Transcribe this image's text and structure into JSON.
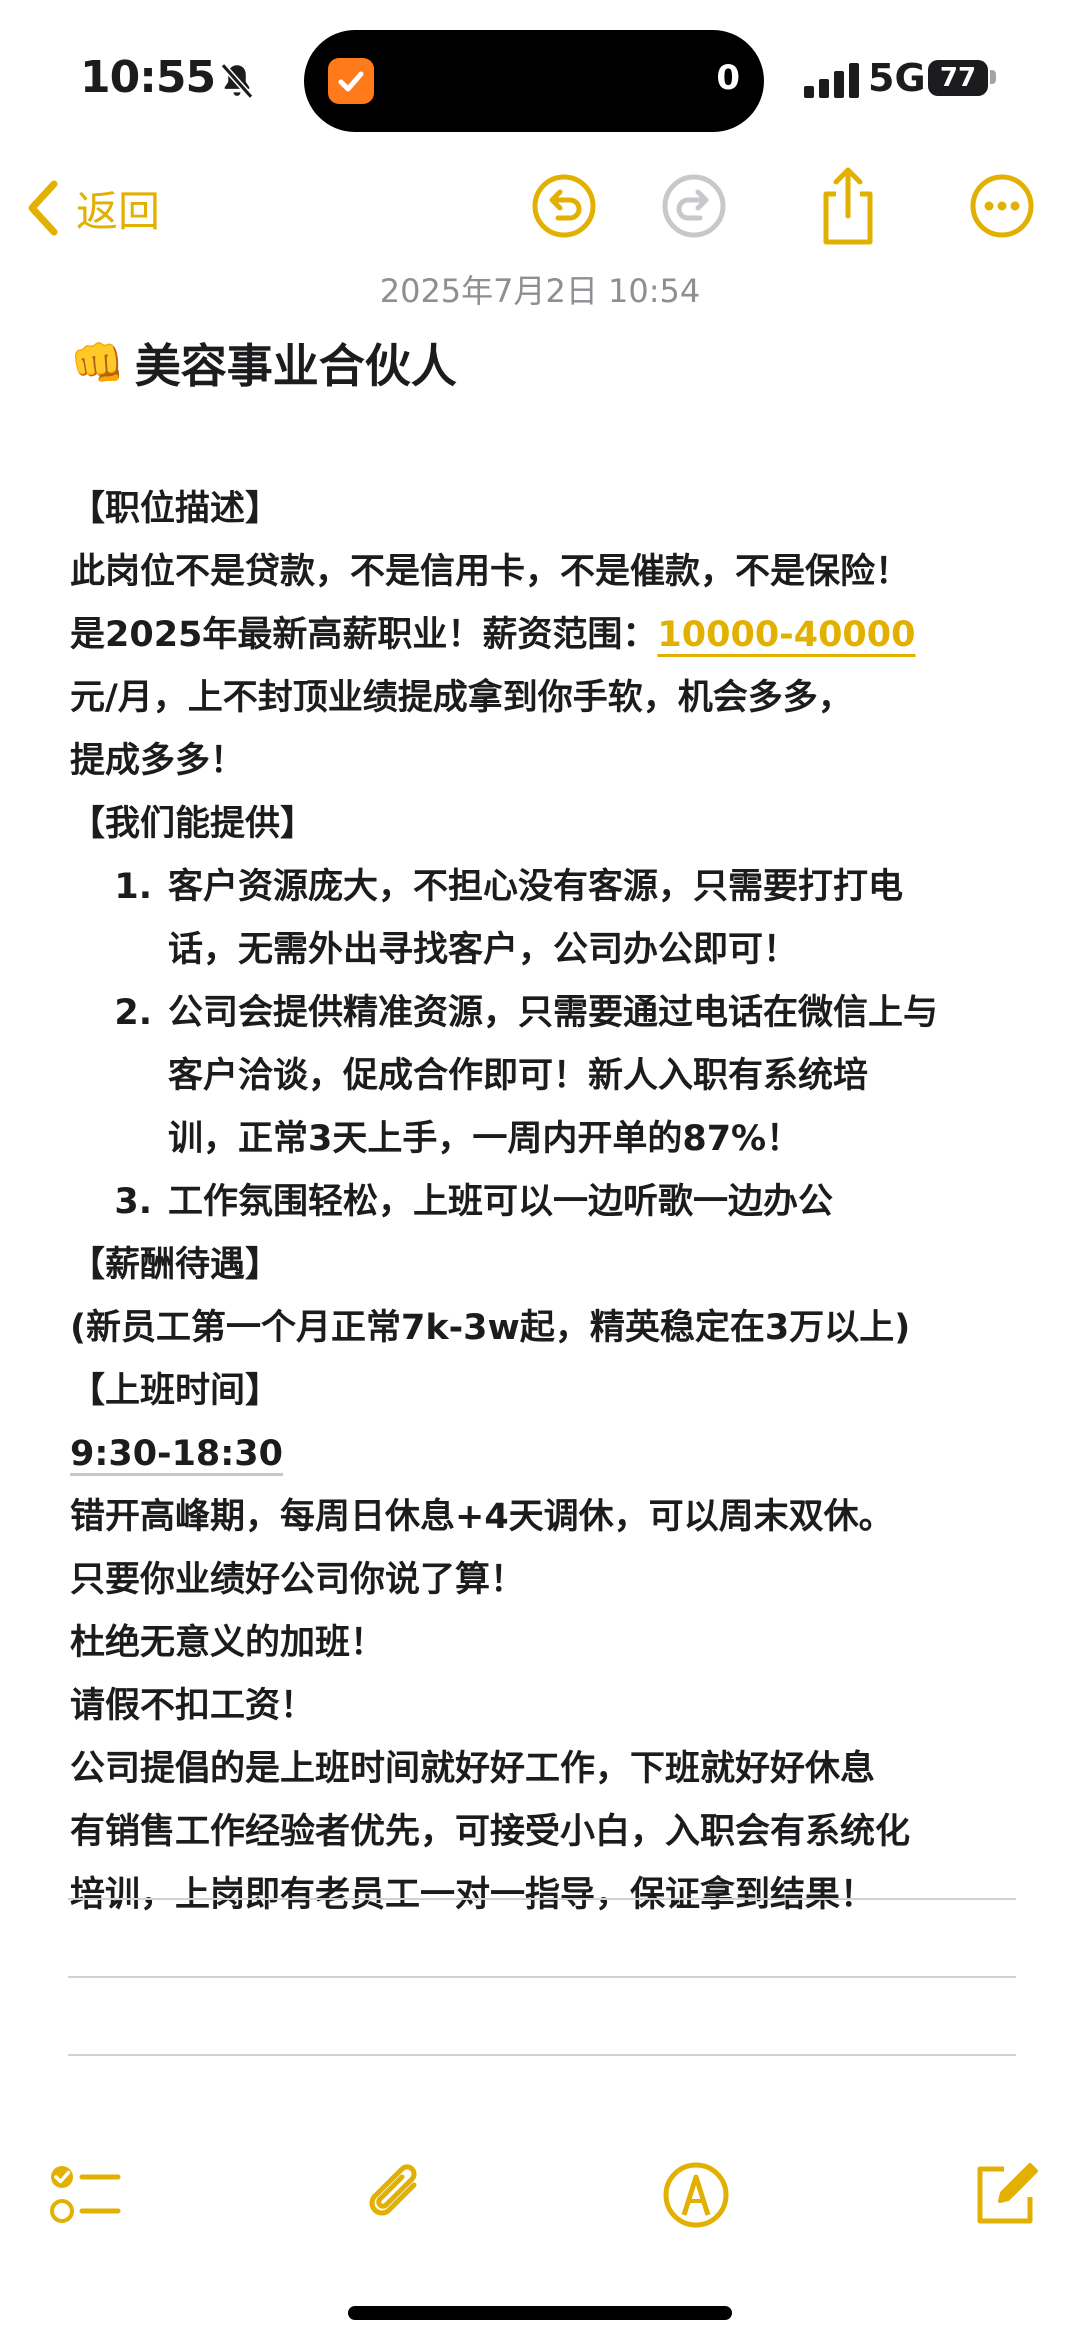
{
  "status_bar": {
    "time": "10:55",
    "island_count": "0",
    "network": "5G",
    "battery": "77"
  },
  "toolbar": {
    "back_label": "返回"
  },
  "note": {
    "date": "2025年7月2日 10:54",
    "title_emoji": "👊",
    "title": "美容事业合伙人",
    "section_job": "【职位描述】",
    "job_line1": "此岗位不是贷款，不是信用卡，不是催款，不是保险！",
    "job_line2_prefix": "是2025年最新高薪职业！薪资范围：",
    "job_salary_link": "10000-40000",
    "job_line3": "元/月，上不封顶业绩提成拿到你手软，机会多多，",
    "job_line4": "提成多多！",
    "section_offer": "【我们能提供】",
    "offer_items": [
      {
        "num": "1.",
        "lines": [
          "客户资源庞大，不担心没有客源，只需要打打电",
          "话，无需外出寻找客户，公司办公即可！"
        ]
      },
      {
        "num": "2.",
        "lines": [
          "公司会提供精准资源，只需要通过电话在微信上与",
          "客户洽谈，促成合作即可！新人入职有系统培",
          "训，正常3天上手，一周内开单的87%！"
        ]
      },
      {
        "num": "3.",
        "lines": [
          "工作氛围轻松，上班可以一边听歌一边办公"
        ]
      }
    ],
    "section_pay": "【薪酬待遇】",
    "pay_line": "(新员工第一个月正常7k-3w起，精英稳定在3万以上)",
    "section_hours": "【上班时间】",
    "hours_link": "9:30-18:30",
    "hours_lines": [
      "错开高峰期，每周日休息+4天调休，可以周末双休。",
      "只要你业绩好公司你说了算！",
      "杜绝无意义的加班！",
      "请假不扣工资！",
      "公司提倡的是上班时间就好好工作，下班就好好休息",
      "有销售工作经验者优先，可接受小白，入职会有系统化",
      "培训，上岗即有老员工一对一指导，保证拿到结果！"
    ]
  },
  "colors": {
    "accent": "#e1b000",
    "text": "#1c1c1e",
    "secondary": "#8e8e93"
  }
}
